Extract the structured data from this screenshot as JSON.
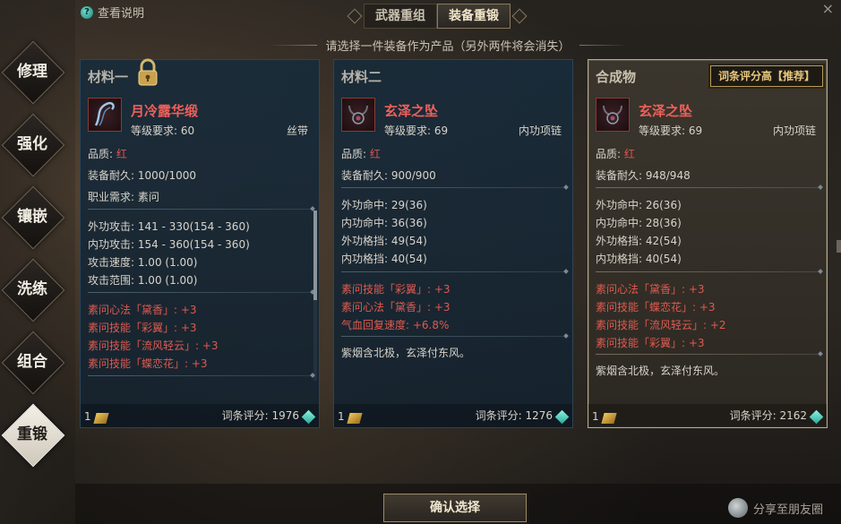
{
  "header": {
    "help_label": "查看说明",
    "help_icon_text": "?",
    "close_label": "×",
    "tabs": [
      {
        "label": "武器重组",
        "active": false
      },
      {
        "label": "装备重锻",
        "active": true
      }
    ],
    "subtitle": "请选择一件装备作为产品（另外两件将会消失）"
  },
  "side_nav": [
    {
      "label": "修理",
      "active": false
    },
    {
      "label": "强化",
      "active": false
    },
    {
      "label": "镶嵌",
      "active": false
    },
    {
      "label": "洗练",
      "active": false
    },
    {
      "label": "组合",
      "active": false
    },
    {
      "label": "重锻",
      "active": true
    }
  ],
  "cards": [
    {
      "header": "材料一",
      "locked": true,
      "item_name": "月冷露华缎",
      "level": "等级要求: 60",
      "type": "丝带",
      "quality_label": "品质:",
      "quality_value": "红",
      "durability": "装备耐久: 1000/1000",
      "class_req": "职业需求: 素问",
      "stats": [
        "外功攻击: 141 - 330(154 - 360)",
        "内功攻击: 154 - 360(154 - 360)",
        "攻击速度: 1.00 (1.00)",
        "攻击范围: 1.00 (1.00)"
      ],
      "attributes": [
        "素问心法「黛香」: +3",
        "素问技能「彩翼」: +3",
        "素问技能「流风轻云」: +3",
        "素问技能「蝶恋花」: +3"
      ],
      "description": "",
      "count": "1",
      "score": "词条评分: 1976"
    },
    {
      "header": "材料二",
      "locked": false,
      "item_name": "玄泽之坠",
      "level": "等级要求: 69",
      "type": "内功项链",
      "quality_label": "品质:",
      "quality_value": "红",
      "durability": "装备耐久: 900/900",
      "class_req": "",
      "stats": [
        "外功命中: 29(36)",
        "内功命中: 36(36)",
        "外功格挡: 49(54)",
        "内功格挡: 40(54)"
      ],
      "attributes": [
        "素问技能「彩翼」: +3",
        "素问心法「黛香」: +3",
        "气血回复速度: +6.8%"
      ],
      "description": "紫烟含北极，玄泽付东风。",
      "count": "1",
      "score": "词条评分: 1276"
    },
    {
      "header": "合成物",
      "locked": false,
      "badge": "词条评分高【推荐】",
      "item_name": "玄泽之坠",
      "level": "等级要求: 69",
      "type": "内功项链",
      "quality_label": "品质:",
      "quality_value": "红",
      "durability": "装备耐久: 948/948",
      "class_req": "",
      "stats": [
        "外功命中: 26(36)",
        "内功命中: 28(36)",
        "外功格挡: 42(54)",
        "内功格挡: 40(54)"
      ],
      "attributes": [
        "素问心法「黛香」: +3",
        "素问技能「蝶恋花」: +3",
        "素问技能「流风轻云」: +2",
        "素问技能「彩翼」: +3"
      ],
      "description": "紫烟含北极，玄泽付东风。",
      "count": "1",
      "score": "词条评分: 2162"
    }
  ],
  "footer": {
    "confirm_label": "确认选择",
    "share_label": "分享至朋友圈"
  },
  "colors": {
    "quality_red": "#e0544f",
    "item_name_red": "#f0605a",
    "recommend_gold": "#e9c77a"
  }
}
